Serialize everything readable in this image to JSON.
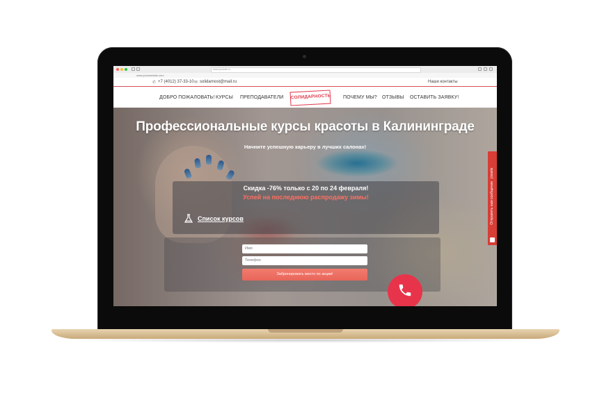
{
  "browser": {
    "tab_title": "www.yourwebsite.com",
    "url": "www.yoursite.ru"
  },
  "contact_bar": {
    "phone": "+7 (4012) 37-33-10",
    "email": "solidarnost@mail.ru",
    "our_contacts": "Наши контакты"
  },
  "nav": {
    "items": [
      "ДОБРО ПОЖАЛОВАТЬ!",
      "КУРСЫ",
      "ПРЕПОДАВАТЕЛИ",
      "ПОЧЕМУ МЫ?",
      "ОТЗЫВЫ",
      "ОСТАВИТЬ ЗАЯВКУ!"
    ],
    "logo": "СОЛИДАРНОСТЬ"
  },
  "hero": {
    "title": "Профессиональные курсы красоты в Калининграде",
    "subtitle": "Начните успешную карьеру в лучших салонах!"
  },
  "promo": {
    "line1": "Скидка -76% только с 20 по 24 февраля!",
    "line2": "Успей на последнюю распродажу зимы!",
    "courses_link": "Список курсов"
  },
  "form": {
    "name_placeholder": "Имя",
    "phone_placeholder": "Телефон",
    "submit": "Забронировать место по акции!"
  },
  "side_tab": {
    "label": "Отправить нам сообщение",
    "brand": "jivosite"
  },
  "colors": {
    "accent": "#e03548",
    "cta": "#f27c6e",
    "side_tab": "#d83d36",
    "promo_highlight": "#ff6f61"
  }
}
